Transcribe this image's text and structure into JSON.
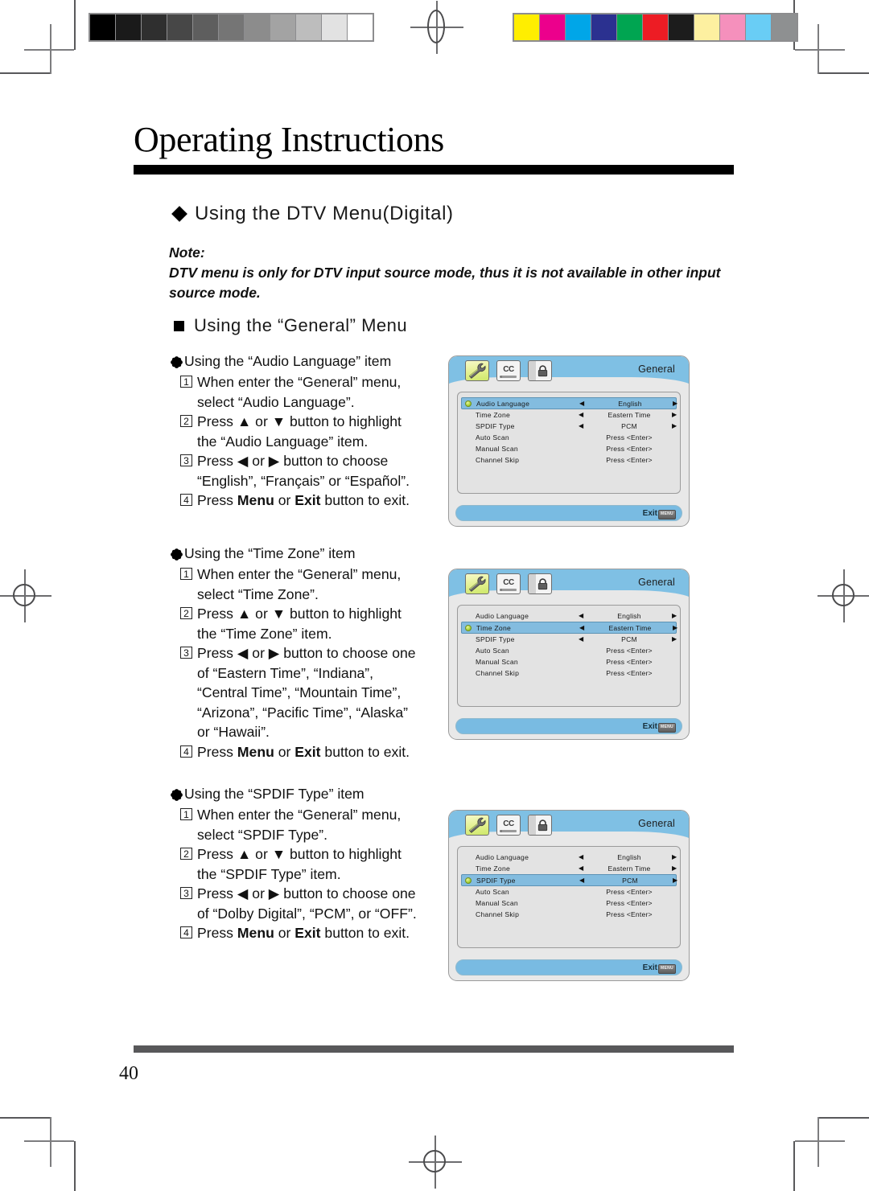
{
  "document": {
    "title": "Operating Instructions",
    "page_number": "40",
    "section_heading": "Using the DTV Menu(Digital)",
    "note_label": "Note:",
    "note_text": "DTV menu is only for DTV input source mode, thus it is not available in other input source mode.",
    "subsection_heading": "Using the “General” Menu"
  },
  "blocks": [
    {
      "heading": "Using the “Audio Language” item",
      "steps": [
        {
          "num": "1",
          "lines": [
            "When enter the “General” menu,",
            "select “Audio Language”."
          ]
        },
        {
          "num": "2",
          "lines": [
            "Press ▲ or ▼ button to highlight",
            "the “Audio Language” item."
          ]
        },
        {
          "num": "3",
          "lines": [
            "Press ◀ or ▶ button to choose",
            "“English”, “Français” or “Español”."
          ]
        },
        {
          "num": "4",
          "lines": [
            "Press <b>Menu</b> or <b>Exit</b> button to exit."
          ]
        }
      ]
    },
    {
      "heading": "Using the “Time Zone” item",
      "steps": [
        {
          "num": "1",
          "lines": [
            "When enter the “General” menu,",
            "select “Time Zone”."
          ]
        },
        {
          "num": "2",
          "lines": [
            "Press ▲ or ▼ button to highlight",
            "the “Time Zone” item."
          ]
        },
        {
          "num": "3",
          "lines": [
            "Press ◀ or ▶ button to choose one",
            "of  “Eastern Time”, “Indiana”,",
            "“Central Time”, “Mountain Time”,",
            "“Arizona”, “Pacific Time”, “Alaska”",
            "or “Hawaii”."
          ]
        },
        {
          "num": "4",
          "lines": [
            "Press <b>Menu</b> or <b>Exit</b>  button to exit."
          ]
        }
      ]
    },
    {
      "heading": "Using the “SPDIF Type” item",
      "steps": [
        {
          "num": "1",
          "lines": [
            "When enter the “General” menu,",
            "select “SPDIF Type”."
          ]
        },
        {
          "num": "2",
          "lines": [
            "Press ▲ or ▼ button to highlight",
            "the “SPDIF Type” item."
          ]
        },
        {
          "num": "3",
          "lines": [
            "Press ◀ or ▶ button to choose one",
            "of “Dolby Digital”, “PCM”, or “OFF”."
          ]
        },
        {
          "num": "4",
          "lines": [
            "Press <b>Menu</b> or <b>Exit</b>  button to exit."
          ]
        }
      ]
    }
  ],
  "osd": {
    "title": "General",
    "exit_label": "Exit",
    "exit_key": "MENU",
    "tabs": [
      {
        "icon": "wrench-icon",
        "active": true
      },
      {
        "icon": "closed-caption-icon",
        "active": false
      },
      {
        "icon": "lock-icon",
        "active": false
      }
    ],
    "rows": [
      {
        "label": "Audio Language",
        "value": "English",
        "arrows": true
      },
      {
        "label": "Time  Zone",
        "value": "Eastern Time",
        "arrows": true
      },
      {
        "label": "SPDIF  Type",
        "value": "PCM",
        "arrows": true
      },
      {
        "label": "Auto  Scan",
        "value": "Press <Enter>",
        "arrows": false
      },
      {
        "label": "Manual  Scan",
        "value": "Press <Enter>",
        "arrows": false
      },
      {
        "label": "Channel  Skip",
        "value": "Press <Enter>",
        "arrows": false
      }
    ],
    "screens": [
      {
        "name": "audio-language-screen",
        "selected_index": 0
      },
      {
        "name": "time-zone-screen",
        "selected_index": 1
      },
      {
        "name": "spdif-type-screen",
        "selected_index": 2
      }
    ]
  },
  "print_marks": {
    "grayscale_swatches": [
      "#000000",
      "#1a1a1a",
      "#2f2f2f",
      "#474747",
      "#5e5e5e",
      "#757575",
      "#8c8c8c",
      "#a3a3a3",
      "#bdbdbd",
      "#e2e2e2",
      "#ffffff"
    ],
    "color_swatches": [
      "#ffee00",
      "#ec008c",
      "#00a6e8",
      "#2b3190",
      "#00a551",
      "#ed1c24",
      "#1c1c1c",
      "#fdf0a0",
      "#f590bc",
      "#69cdf5",
      "#8e9091"
    ]
  },
  "colors": {
    "osd_header": "#7fc0e4",
    "osd_highlight": "#83bcdf",
    "osd_body": "#e3e3e3",
    "title_rule": "#000000",
    "footer_rule": "#58585a"
  }
}
